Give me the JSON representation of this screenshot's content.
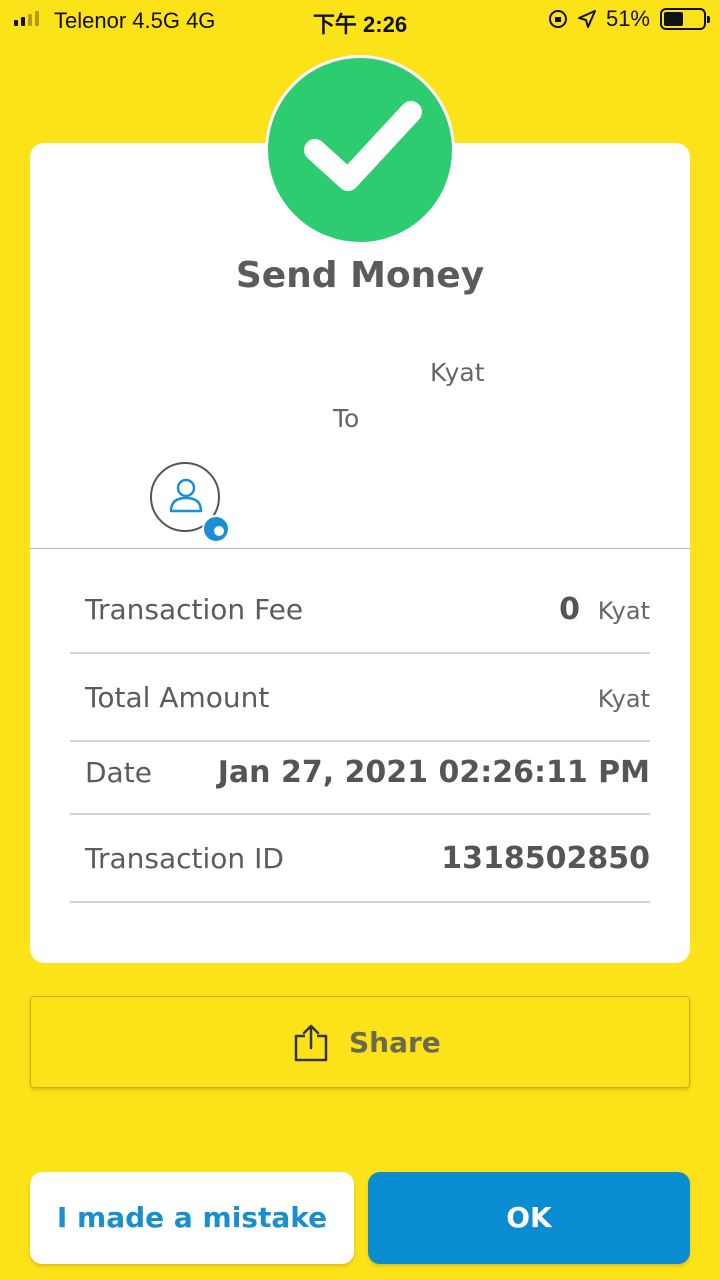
{
  "status_bar": {
    "carrier": "Telenor 4.5G   4G",
    "time": "下午 2:26",
    "battery_percent": "51%",
    "battery_level": 0.51
  },
  "receipt": {
    "title": "Send Money",
    "amount_unit": "Kyat",
    "to_label": "To",
    "rows": {
      "fee": {
        "label": "Transaction Fee",
        "value": "0",
        "unit": "Kyat"
      },
      "total": {
        "label": "Total Amount",
        "unit": "Kyat"
      },
      "date": {
        "label": "Date",
        "value": "Jan 27, 2021 02:26:11 PM"
      },
      "txid": {
        "label": "Transaction ID",
        "value": "1318502850"
      }
    }
  },
  "actions": {
    "share_label": "Share",
    "mistake_label": "I made a mistake",
    "ok_label": "OK"
  },
  "colors": {
    "background": "#FCE218",
    "success": "#2ECC71",
    "primary": "#0A8DD0"
  }
}
